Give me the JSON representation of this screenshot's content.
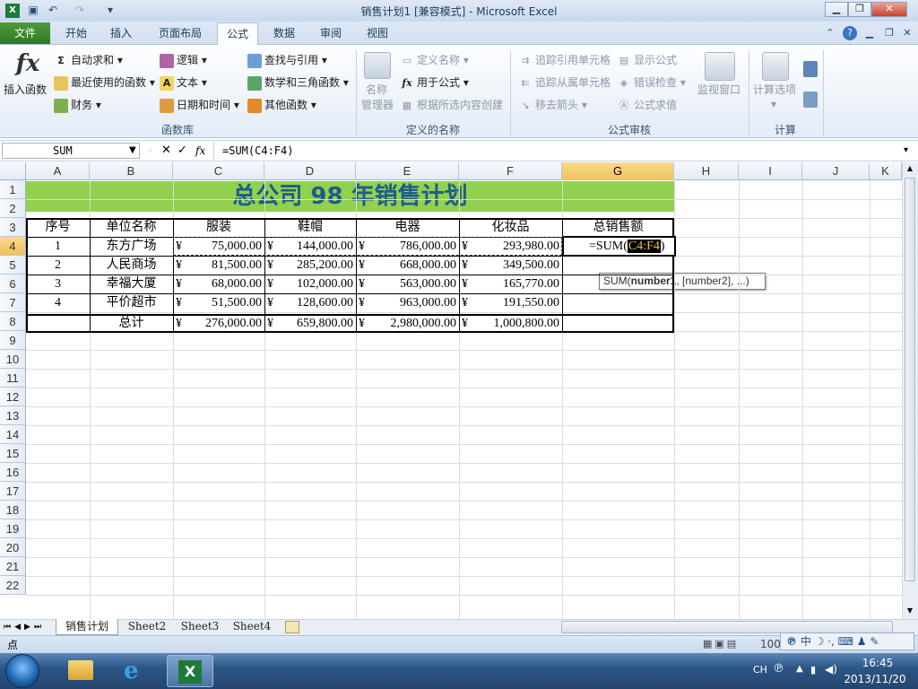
{
  "window": {
    "title": "销售计划1 [兼容模式] - Microsoft Excel"
  },
  "quick_access": {
    "save_icon": "save-icon",
    "undo_icon": "undo-icon",
    "redo_icon": "redo-icon",
    "customize": "▾"
  },
  "win_controls": {
    "minimize": "▁",
    "restore": "❐",
    "close": "✕"
  },
  "tabs": [
    {
      "label": "文件"
    },
    {
      "label": "开始"
    },
    {
      "label": "插入"
    },
    {
      "label": "页面布局"
    },
    {
      "label": "公式"
    },
    {
      "label": "数据"
    },
    {
      "label": "审阅"
    },
    {
      "label": "视图"
    }
  ],
  "ribbon": {
    "function_library": {
      "insert_function": "插入函数",
      "autosum": "自动求和",
      "recent": "最近使用的函数",
      "financial": "财务",
      "logical": "逻辑",
      "text": "文本",
      "datetime": "日期和时间",
      "lookup": "查找与引用",
      "math": "数学和三角函数",
      "other": "其他函数",
      "group_label": "函数库"
    },
    "defined_names": {
      "name_manager_1": "名称",
      "name_manager_2": "管理器",
      "define_name": "定义名称",
      "use_in_formula": "用于公式",
      "create_from_selection": "根据所选内容创建",
      "group_label": "定义的名称"
    },
    "formula_auditing": {
      "trace_precedents": "追踪引用单元格",
      "trace_dependents": "追踪从属单元格",
      "remove_arrows": "移去箭头",
      "show_formulas": "显示公式",
      "error_checking": "错误检查",
      "evaluate_formula": "公式求值",
      "watch_window": "监视窗口",
      "group_label": "公式审核"
    },
    "calculation": {
      "options": "计算选项",
      "group_label": "计算"
    }
  },
  "formula_bar": {
    "name_box": "SUM",
    "formula": "=SUM(C4:F4)",
    "fx": "fx"
  },
  "columns": [
    "A",
    "B",
    "C",
    "D",
    "E",
    "F",
    "G",
    "H",
    "I",
    "J",
    "K"
  ],
  "rows": [
    "1",
    "2",
    "3",
    "4",
    "5",
    "6",
    "7",
    "8",
    "9",
    "10",
    "11",
    "12",
    "13",
    "14",
    "15",
    "16",
    "17",
    "18",
    "19",
    "20",
    "21",
    "22"
  ],
  "sheet": {
    "title": "总公司 98 年销售计划",
    "headers": [
      "序号",
      "单位名称",
      "服装",
      "鞋帽",
      "电器",
      "化妆品",
      "总销售额"
    ],
    "data": [
      [
        "1",
        "东方广场",
        "75,000.00",
        "144,000.00",
        "786,000.00",
        "293,980.00"
      ],
      [
        "2",
        "人民商场",
        "81,500.00",
        "285,200.00",
        "668,000.00",
        "349,500.00"
      ],
      [
        "3",
        "幸福大厦",
        "68,000.00",
        "102,000.00",
        "563,000.00",
        "165,770.00"
      ],
      [
        "4",
        "平价超市",
        "51,500.00",
        "128,600.00",
        "963,000.00",
        "191,550.00"
      ]
    ],
    "total_label": "总计",
    "totals": [
      "276,000.00",
      "659,800.00",
      "2,980,000.00",
      "1,000,800.00"
    ],
    "currency": "¥",
    "editing": {
      "prefix": "=SUM(",
      "ref": "C4:F4",
      "suffix": ")"
    },
    "tooltip": {
      "fn": "SUM(",
      "bold": "number1",
      "rest": ", [number2], ...)"
    }
  },
  "sheet_tabs": [
    "销售计划",
    "Sheet2",
    "Sheet3",
    "Sheet4"
  ],
  "status": {
    "mode": "点",
    "zoom": "100",
    "ime": "中"
  },
  "taskbar": {
    "lang": "CH",
    "time": "16:45",
    "date": "2013/11/20"
  },
  "colors": {
    "title_fill": "#92d050",
    "title_text": "#1f5c8a",
    "active_col": "#f1c15d",
    "file_tab": "#2e7a24"
  }
}
